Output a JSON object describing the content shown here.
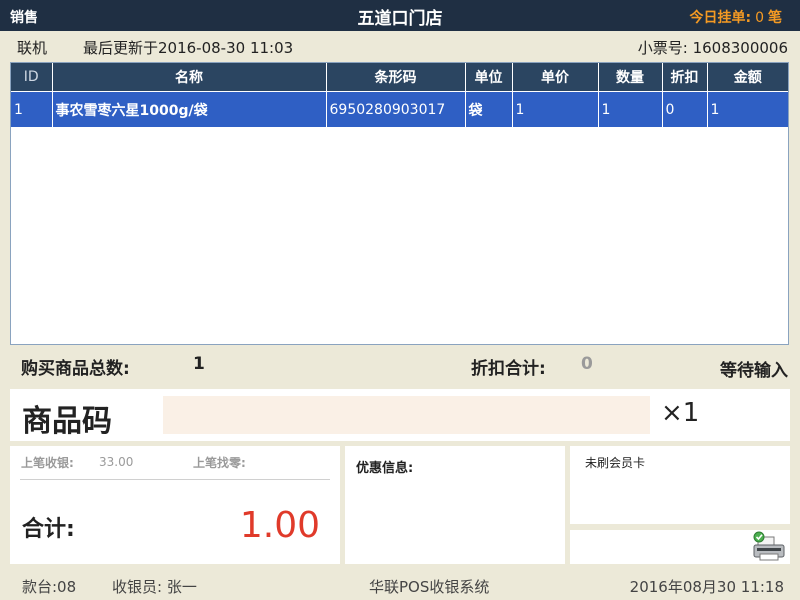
{
  "topbar": {
    "mode": "销售",
    "store_name": "五道口门店",
    "pending_label": "今日挂单:",
    "pending_count": "0",
    "pending_unit": "笔"
  },
  "info": {
    "online_status": "联机",
    "last_update": "最后更新于2016-08-30 11:03",
    "receipt_label": "小票号:",
    "receipt_number": "1608300006"
  },
  "table": {
    "headers": [
      "ID",
      "名称",
      "条形码",
      "单位",
      "单价",
      "数量",
      "折扣",
      "金额"
    ],
    "rows": [
      {
        "id": "1",
        "name": "事农雪枣六星1000g/袋",
        "barcode": "6950280903017",
        "unit": "袋",
        "price": "1",
        "qty": "1",
        "discount": "0",
        "amount": "1"
      }
    ]
  },
  "summary": {
    "total_items_label": "购买商品总数:",
    "total_items": "1",
    "discount_label": "折扣合计:",
    "discount_total": "0",
    "status": "等待输入"
  },
  "entry": {
    "code_label": "商品码",
    "code_value": "",
    "multiplier": "×1"
  },
  "payment": {
    "last_received_label": "上笔收银:",
    "last_received_value": "33.00",
    "last_change_label": "上笔找零:",
    "last_change_value": "",
    "sum_label": "合计:",
    "sum_value": "1.00"
  },
  "promo": {
    "label": "优惠信息:"
  },
  "member": {
    "status": "未刷会员卡"
  },
  "footer": {
    "register": "款台:08",
    "cashier": "收银员: 张一",
    "system_name": "华联POS收银系统",
    "datetime": "2016年08月30  11:18"
  },
  "colors": {
    "topbar_bg": "#1f2f43",
    "table_header_bg": "#2b4561",
    "selected_row_bg": "#2f5fc4",
    "pending_accent": "#f59a23",
    "sum_red": "#e03a2a",
    "input_bg": "#faf0e6"
  },
  "icons": {
    "printer": "printer-icon"
  }
}
